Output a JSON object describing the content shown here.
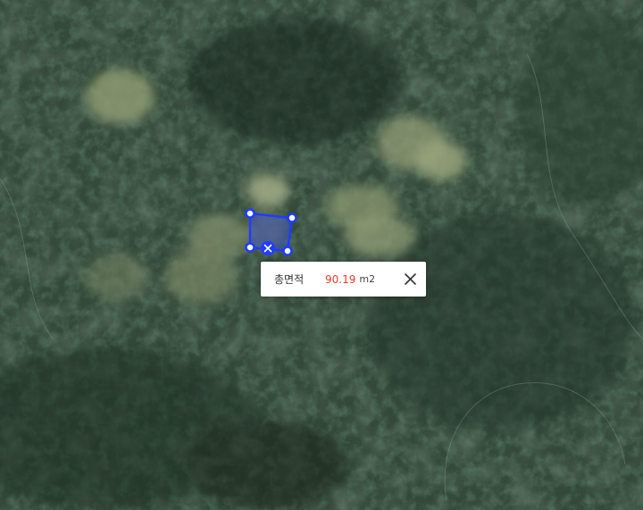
{
  "map": {
    "view": "satellite",
    "accent_color": "#1f3cff",
    "measurement": {
      "tool": "area",
      "vertex_count": 4
    }
  },
  "popup": {
    "label": "총면적",
    "value": "90.19",
    "unit": "m2",
    "value_color": "#e83b2f",
    "close_icon": "close-icon"
  }
}
